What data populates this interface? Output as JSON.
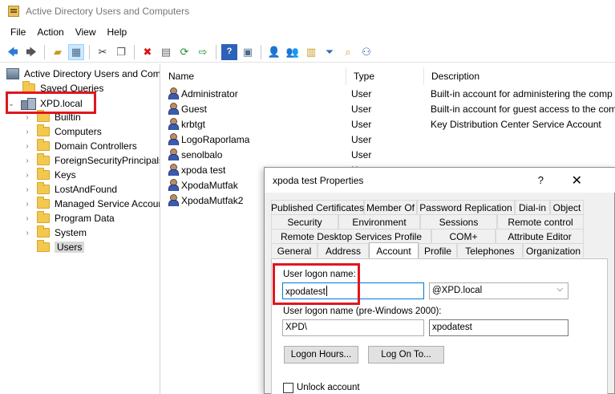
{
  "window": {
    "title": "Active Directory Users and Computers"
  },
  "menu": [
    "File",
    "Action",
    "View",
    "Help"
  ],
  "toolbar": {
    "icons": [
      "back-arrow",
      "forward-arrow",
      "up-folder",
      "console-tree",
      "cut",
      "copy",
      "delete",
      "properties",
      "refresh",
      "export-list",
      "help",
      "console",
      "new-user",
      "new-group",
      "new-ou",
      "filter",
      "find",
      "add-to-group"
    ]
  },
  "tree": {
    "root": "Active Directory Users and Com",
    "saved_queries": "Saved Queries",
    "domain": "XPD.local",
    "children": [
      "Builtin",
      "Computers",
      "Domain Controllers",
      "ForeignSecurityPrincipals",
      "Keys",
      "LostAndFound",
      "Managed Service Accour",
      "Program Data",
      "System",
      "Users"
    ]
  },
  "list": {
    "columns": [
      "Name",
      "Type",
      "Description"
    ],
    "rows": [
      {
        "name": "Administrator",
        "type": "User",
        "description": "Built-in account for administering the comp"
      },
      {
        "name": "Guest",
        "type": "User",
        "description": "Built-in account for guest access to the com"
      },
      {
        "name": "krbtgt",
        "type": "User",
        "description": "Key Distribution Center Service Account"
      },
      {
        "name": "LogoRaporlama",
        "type": "User",
        "description": ""
      },
      {
        "name": "senolbalo",
        "type": "User",
        "description": ""
      },
      {
        "name": "xpoda test",
        "type": "U",
        "description": ""
      },
      {
        "name": "XpodaMutfak",
        "type": "",
        "description": ""
      },
      {
        "name": "XpodaMutfak2",
        "type": "",
        "description": ""
      }
    ]
  },
  "dialog": {
    "title": "xpoda test Properties",
    "help": "?",
    "close": "✕",
    "tabs_row1": [
      "Published Certificates",
      "Member Of",
      "Password Replication",
      "Dial-in",
      "Object"
    ],
    "tabs_row2": [
      "Security",
      "Environment",
      "Sessions",
      "Remote control"
    ],
    "tabs_row3": [
      "Remote Desktop Services Profile",
      "COM+",
      "Attribute Editor"
    ],
    "tabs_row4": [
      "General",
      "Address",
      "Account",
      "Profile",
      "Telephones",
      "Organization"
    ],
    "active_tab": "Account",
    "logon_label": "User logon name:",
    "logon_value": "xpodatest",
    "upn_suffix": "@XPD.local",
    "pre2000_label": "User logon name (pre-Windows 2000):",
    "pre2000_domain": "XPD\\",
    "pre2000_value": "xpodatest",
    "logon_hours_btn": "Logon Hours...",
    "logon_to_btn": "Log On To...",
    "unlock_label": "Unlock account"
  },
  "colors": {
    "highlight": "#e0161f",
    "selection": "#d9d9d9"
  }
}
